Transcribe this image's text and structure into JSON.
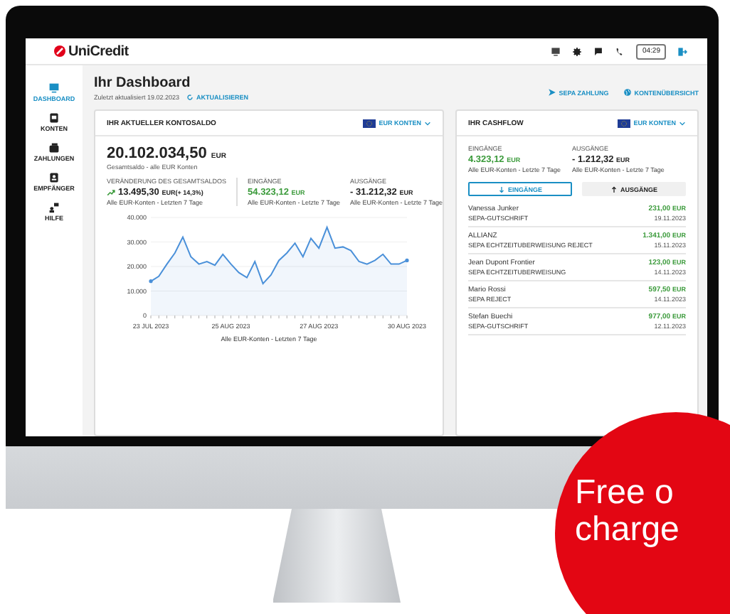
{
  "header": {
    "brand": "UniCredit",
    "time": "04:29"
  },
  "sidebar": {
    "items": [
      {
        "label": "DASHBOARD",
        "selected": true
      },
      {
        "label": "KONTEN",
        "selected": false
      },
      {
        "label": "ZAHLUNGEN",
        "selected": false
      },
      {
        "label": "EMPFÄNGER",
        "selected": false
      },
      {
        "label": "HILFE",
        "selected": false
      }
    ]
  },
  "dashboard": {
    "title": "Ihr Dashboard",
    "updated": "Zuletzt aktualisiert 19.02.2023",
    "refresh": "AKTUALISIEREN",
    "actions": [
      "SEPA ZAHLUNG",
      "KONTENÜBERSICHT"
    ]
  },
  "balance_card": {
    "title": "IHR AKTUELLER KONTOSALDO",
    "account_filter": "EUR KONTEN",
    "amount": "20.102.034,50",
    "currency": "EUR",
    "subtitle": "Gesamtsaldo - alle EUR Konten",
    "stats": [
      {
        "kind": "trend",
        "label": "VERÄNDERUNG DES GESAMTSALDOS",
        "value": "13.495,30",
        "currency": "EUR",
        "change": "(+ 14,3%)",
        "note": "Alle EUR-Konten - Letzten 7 Tage"
      },
      {
        "kind": "income",
        "label": "EINGÄNGE",
        "value": "54.323,12",
        "currency": "EUR",
        "note": "Alle EUR-Konten - Letzte 7 Tage"
      },
      {
        "kind": "expense",
        "label": "AUSGÄNGE",
        "value": "- 31.212,32",
        "currency": "EUR",
        "note": "Alle EUR-Konten - Letzte 7 Tage"
      }
    ],
    "chart_data": {
      "type": "area",
      "xlabel": "Alle EUR-Konten - Letzten 7 Tage",
      "categories": [
        "23 JUL 2023",
        null,
        null,
        null,
        null,
        null,
        null,
        null,
        null,
        null,
        "25 AUG 2023",
        null,
        null,
        null,
        null,
        null,
        null,
        null,
        null,
        null,
        null,
        "27 AUG 2023",
        null,
        null,
        null,
        null,
        null,
        null,
        null,
        null,
        null,
        null,
        "30 AUG 2023"
      ],
      "series": [
        {
          "color": "#4a90d9",
          "values": [
            14000,
            16000,
            21000,
            25500,
            32000,
            24000,
            21000,
            22000,
            20500,
            25000,
            21000,
            17500,
            15500,
            22000,
            13000,
            16500,
            22500,
            25500,
            29500,
            24000,
            31500,
            27500,
            36000,
            27500,
            28000,
            26500,
            22000,
            21000,
            22500,
            25000,
            21000,
            21000,
            22500
          ]
        }
      ],
      "grid": true,
      "ylim": [
        0,
        40000
      ],
      "yticks": [
        {
          "value": 0,
          "label": "0"
        },
        {
          "value": 10000,
          "label": "10.000"
        },
        {
          "value": 20000,
          "label": "20.000"
        },
        {
          "value": 30000,
          "label": "30.000"
        },
        {
          "value": 40000,
          "label": "40.000"
        }
      ]
    }
  },
  "cashflow_card": {
    "title": "IHR CASHFLOW",
    "account_filter": "EUR KONTEN",
    "stats": [
      {
        "kind": "income",
        "label": "EINGÄNGE",
        "value": "4.323,12",
        "currency": "EUR",
        "note": "Alle EUR-Konten - Letzte 7 Tage"
      },
      {
        "kind": "expense",
        "label": "AUSGÄNGE",
        "value": "- 1.212,32",
        "currency": "EUR",
        "note": "Alle EUR-Konten - Letzte 7 Tage"
      }
    ],
    "tabs": [
      {
        "label": "EINGÄNGE",
        "selected": true
      },
      {
        "label": "AUSGÄNGE",
        "selected": false
      }
    ],
    "transactions": [
      {
        "name": "Vanessa Junker",
        "type": "SEPA-GUTSCHRIFT",
        "amount": "231,00",
        "currency": "EUR",
        "date": "19.11.2023"
      },
      {
        "name": "ALLIANZ",
        "type": "SEPA ECHTZEITUBERWEISUNG REJECT",
        "amount": "1.341,00",
        "currency": "EUR",
        "date": "15.11.2023"
      },
      {
        "name": "Jean Dupont Frontier",
        "type": "SEPA ECHTZEITUBERWEISUNG",
        "amount": "123,00",
        "currency": "EUR",
        "date": "14.11.2023"
      },
      {
        "name": "Mario Rossi",
        "type": "SEPA REJECT",
        "amount": "597,50",
        "currency": "EUR",
        "date": "14.11.2023"
      },
      {
        "name": "Stefan Buechi",
        "type": "SEPA-GUTSCHRIFT",
        "amount": "977,00",
        "currency": "EUR",
        "date": "12.11.2023"
      }
    ]
  },
  "badge": {
    "lines": [
      "Free o",
      "charge"
    ]
  }
}
